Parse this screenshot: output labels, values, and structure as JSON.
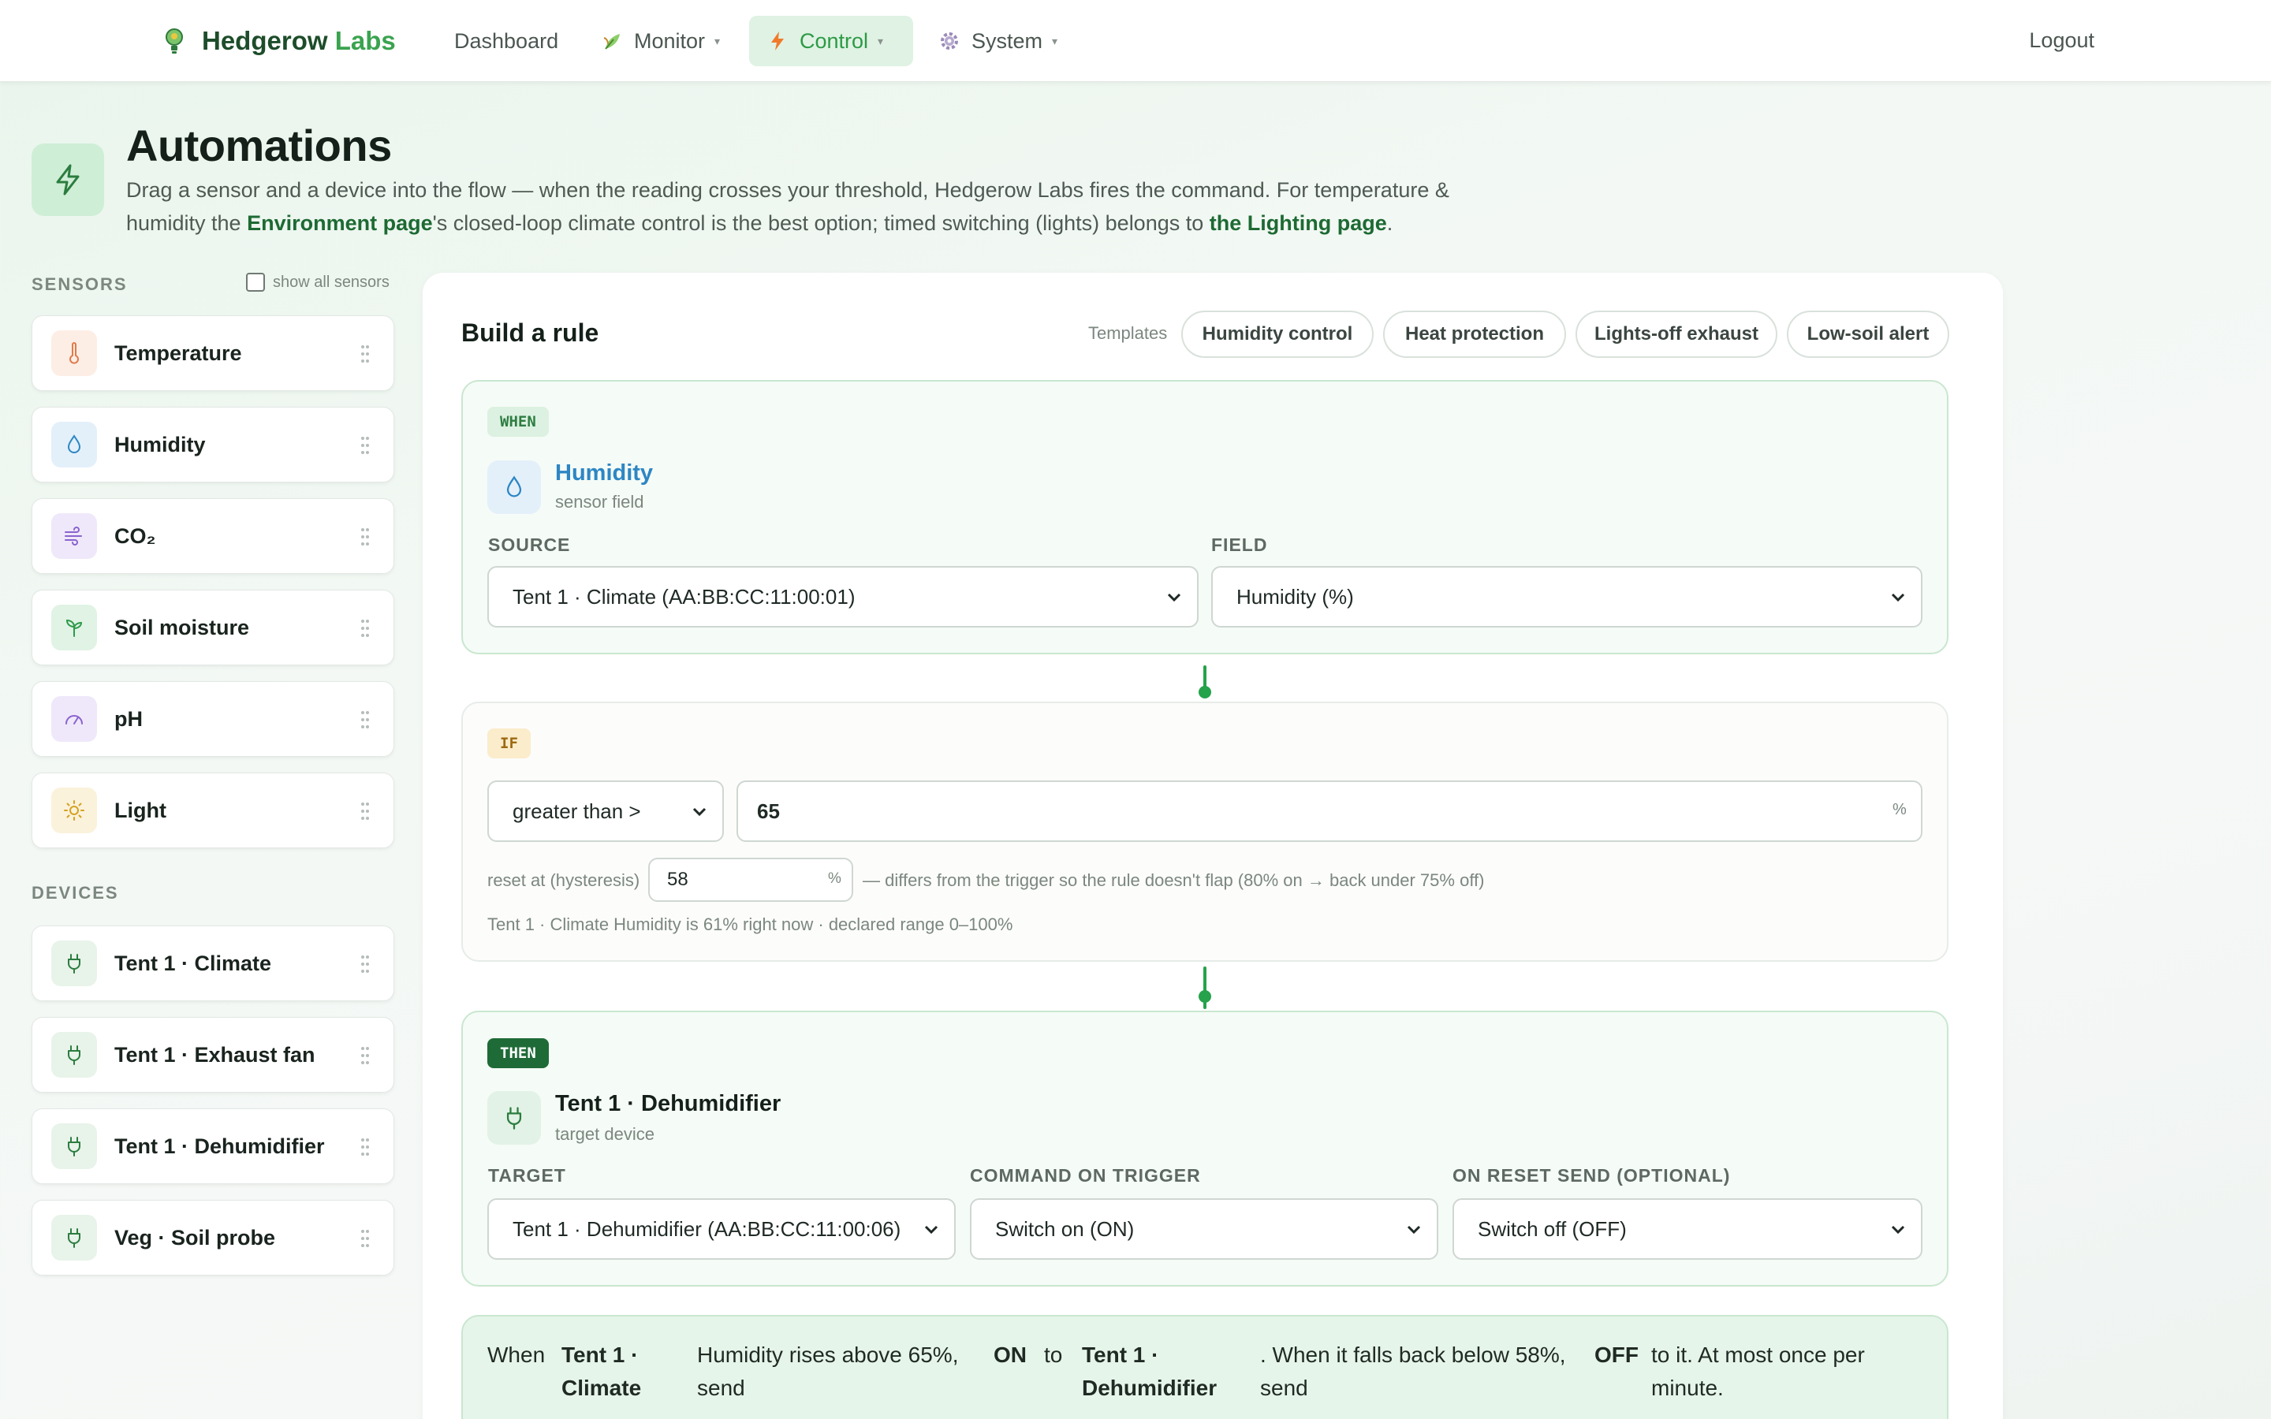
{
  "nav": {
    "brand_main": "Hedgerow",
    "brand_accent": "Labs",
    "items": [
      {
        "label": "Dashboard"
      },
      {
        "label": "Monitor",
        "caret": "▾"
      },
      {
        "label": "Control",
        "caret": "▾"
      },
      {
        "label": "System",
        "caret": "▾"
      }
    ],
    "logout": "Logout",
    "active_color": "#2d9a45"
  },
  "header": {
    "title": "Automations",
    "desc_1": "Drag a sensor and a device into the flow — when the reading crosses your threshold, Hedgerow Labs fires the command. For temperature & humidity the ",
    "link_env": "Environment page",
    "desc_2": "'s closed-loop climate control is the best option; timed switching (lights) belongs to ",
    "link_light": "the Lighting page",
    "desc_3": "."
  },
  "sidebar": {
    "sensors_heading": "SENSORS",
    "show_all_label": "show all sensors",
    "sensors": [
      {
        "label": "Temperature",
        "icon": "thermometer-icon",
        "bg": "#fdeee5",
        "color": "#e07b4a"
      },
      {
        "label": "Humidity",
        "icon": "droplet-icon",
        "bg": "#e3f0fa",
        "color": "#2d86c4"
      },
      {
        "label": "CO₂",
        "icon": "wind-icon",
        "bg": "#efe8fa",
        "color": "#8a63cf"
      },
      {
        "label": "Soil moisture",
        "icon": "sprout-icon",
        "bg": "#e0f3e5",
        "color": "#2e9a4a"
      },
      {
        "label": "pH",
        "icon": "gauge-icon",
        "bg": "#efe8fa",
        "color": "#8a63cf"
      },
      {
        "label": "Light",
        "icon": "sun-icon",
        "bg": "#fbf2dc",
        "color": "#d5a21f"
      }
    ],
    "devices_heading": "DEVICES",
    "devices": [
      {
        "label": "Tent 1 · Climate"
      },
      {
        "label": "Tent 1 · Exhaust fan"
      },
      {
        "label": "Tent 1 · Dehumidifier"
      },
      {
        "label": "Veg · Soil probe"
      }
    ]
  },
  "builder": {
    "title": "Build a rule",
    "templates_label": "Templates",
    "templates": [
      "Humidity control",
      "Heat protection",
      "Lights-off exhaust",
      "Low-soil alert"
    ],
    "when": {
      "badge": "WHEN",
      "name": "Humidity",
      "sub": "sensor field",
      "source_label": "SOURCE",
      "source_value": "Tent 1 · Climate (AA:BB:CC:11:00:01)",
      "field_label": "FIELD",
      "field_value": "Humidity (%)"
    },
    "if": {
      "badge": "IF",
      "operator": "greater than >",
      "threshold": "65",
      "unit": "%",
      "reset_label": "reset at (hysteresis)",
      "reset_value": "58",
      "reset_unit": "%",
      "reset_note": "— differs from the trigger so the rule doesn't flap (80% on → back under 75% off)",
      "status": "Tent 1 · Climate Humidity is 61% right now · declared range 0–100%"
    },
    "then": {
      "badge": "THEN",
      "name": "Tent 1 · Dehumidifier",
      "sub": "target device",
      "target_label": "TARGET",
      "target_value": "Tent 1 · Dehumidifier (AA:BB:CC:11:00:06)",
      "command_label": "COMMAND ON TRIGGER",
      "command_value": "Switch on (ON)",
      "reset_label": "ON RESET SEND (OPTIONAL)",
      "reset_value": "Switch off (OFF)"
    },
    "summary": {
      "when": "When",
      "src_1": "Tent 1 ·",
      "src_2": "Climate",
      "cond_1": "Humidity rises above 65%,",
      "cond_2": "send",
      "on": "ON",
      "to": "to",
      "dev_1": "Tent 1 ·",
      "dev_2": "Dehumidifier",
      "fall_1": ". When it falls back below 58%,",
      "fall_2": "send",
      "off": "OFF",
      "tail_1": "to it. At most once per",
      "tail_2": "minute."
    }
  }
}
